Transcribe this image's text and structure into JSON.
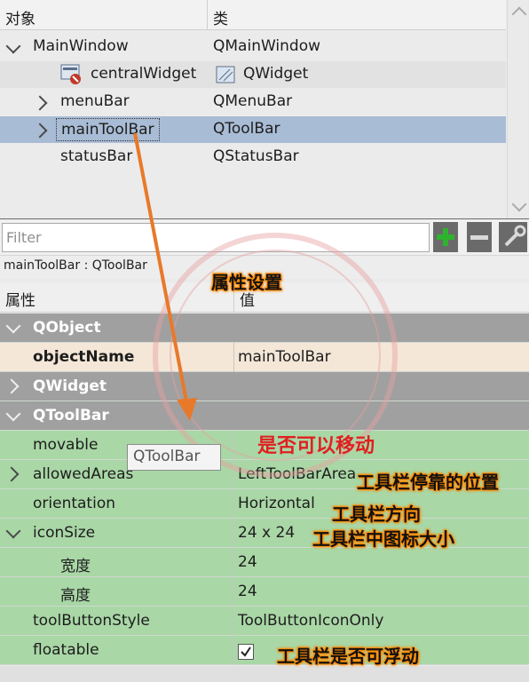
{
  "inspector": {
    "header": {
      "object": "对象",
      "class": "类"
    },
    "rows": [
      {
        "name": "MainWindow",
        "class": "QMainWindow"
      },
      {
        "name": "centralWidget",
        "class": "QWidget"
      },
      {
        "name": "menuBar",
        "class": "QMenuBar"
      },
      {
        "name": "mainToolBar",
        "class": "QToolBar"
      },
      {
        "name": "statusBar",
        "class": "QStatusBar"
      }
    ]
  },
  "filter": {
    "placeholder": "Filter"
  },
  "current_object": "mainToolBar : QToolBar",
  "property_editor": {
    "header": {
      "property": "属性",
      "value": "值"
    },
    "groups": {
      "qobject": "QObject",
      "qwidget": "QWidget",
      "qtoolbar": "QToolBar"
    },
    "rows": [
      {
        "name": "objectName",
        "value": "mainToolBar"
      },
      {
        "name": "movable",
        "value": ""
      },
      {
        "name": "allowedAreas",
        "value": "LeftToolBarArea"
      },
      {
        "name": "orientation",
        "value": "Horizontal"
      },
      {
        "name": "iconSize",
        "value": "24 x 24"
      },
      {
        "name": "宽度",
        "value": "24"
      },
      {
        "name": "高度",
        "value": "24"
      },
      {
        "name": "toolButtonStyle",
        "value": "ToolButtonIconOnly"
      },
      {
        "name": "floatable",
        "value": "checked"
      }
    ]
  },
  "tooltip": "QToolBar",
  "annotations": {
    "property_settings": "属性设置",
    "movable": "是否可以移动",
    "allowed_areas": "工具栏停靠的位置",
    "orientation": "工具栏方向",
    "icon_size": "工具栏中图标大小",
    "floatable": "工具栏是否可浮动"
  },
  "colors": {
    "accent_arrow": "#e8792a",
    "selection": "#a9bcd5",
    "group_header": "#a0a0a0",
    "property_row": "#a9d7a6"
  }
}
